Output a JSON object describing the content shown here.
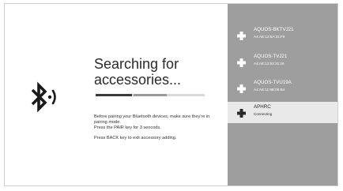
{
  "search": {
    "title": "Searching for accessories...",
    "progress_segments": [
      "dark",
      "light"
    ],
    "instructions": [
      "Before pairing your Bluetooth devices, make sure they're in pairing mode.",
      "Press the PAIR key for 3 sencods.",
      "Press BACK key to exit accessory adding."
    ]
  },
  "icons": {
    "bluetooth": "bluetooth-searching-icon",
    "device": "gamepad-icon"
  },
  "devices": [
    {
      "name": "AQUOS-BKTVJ21",
      "detail": "A4:AE:12:5A:31:F9",
      "selected": false
    },
    {
      "name": "AQUOS-TVJ21",
      "detail": "A4:AE:12:52:31:16",
      "selected": false
    },
    {
      "name": "AQUOS-TVU19A",
      "detail": "A4:AE:11:5B:06:B4",
      "selected": false
    },
    {
      "name": "APHRC",
      "detail": "Connecting",
      "selected": true
    }
  ],
  "colors": {
    "right_panel": "#9e9e9e",
    "selected_row": "#e9e9e9",
    "text_dark": "#2a2a2a"
  }
}
